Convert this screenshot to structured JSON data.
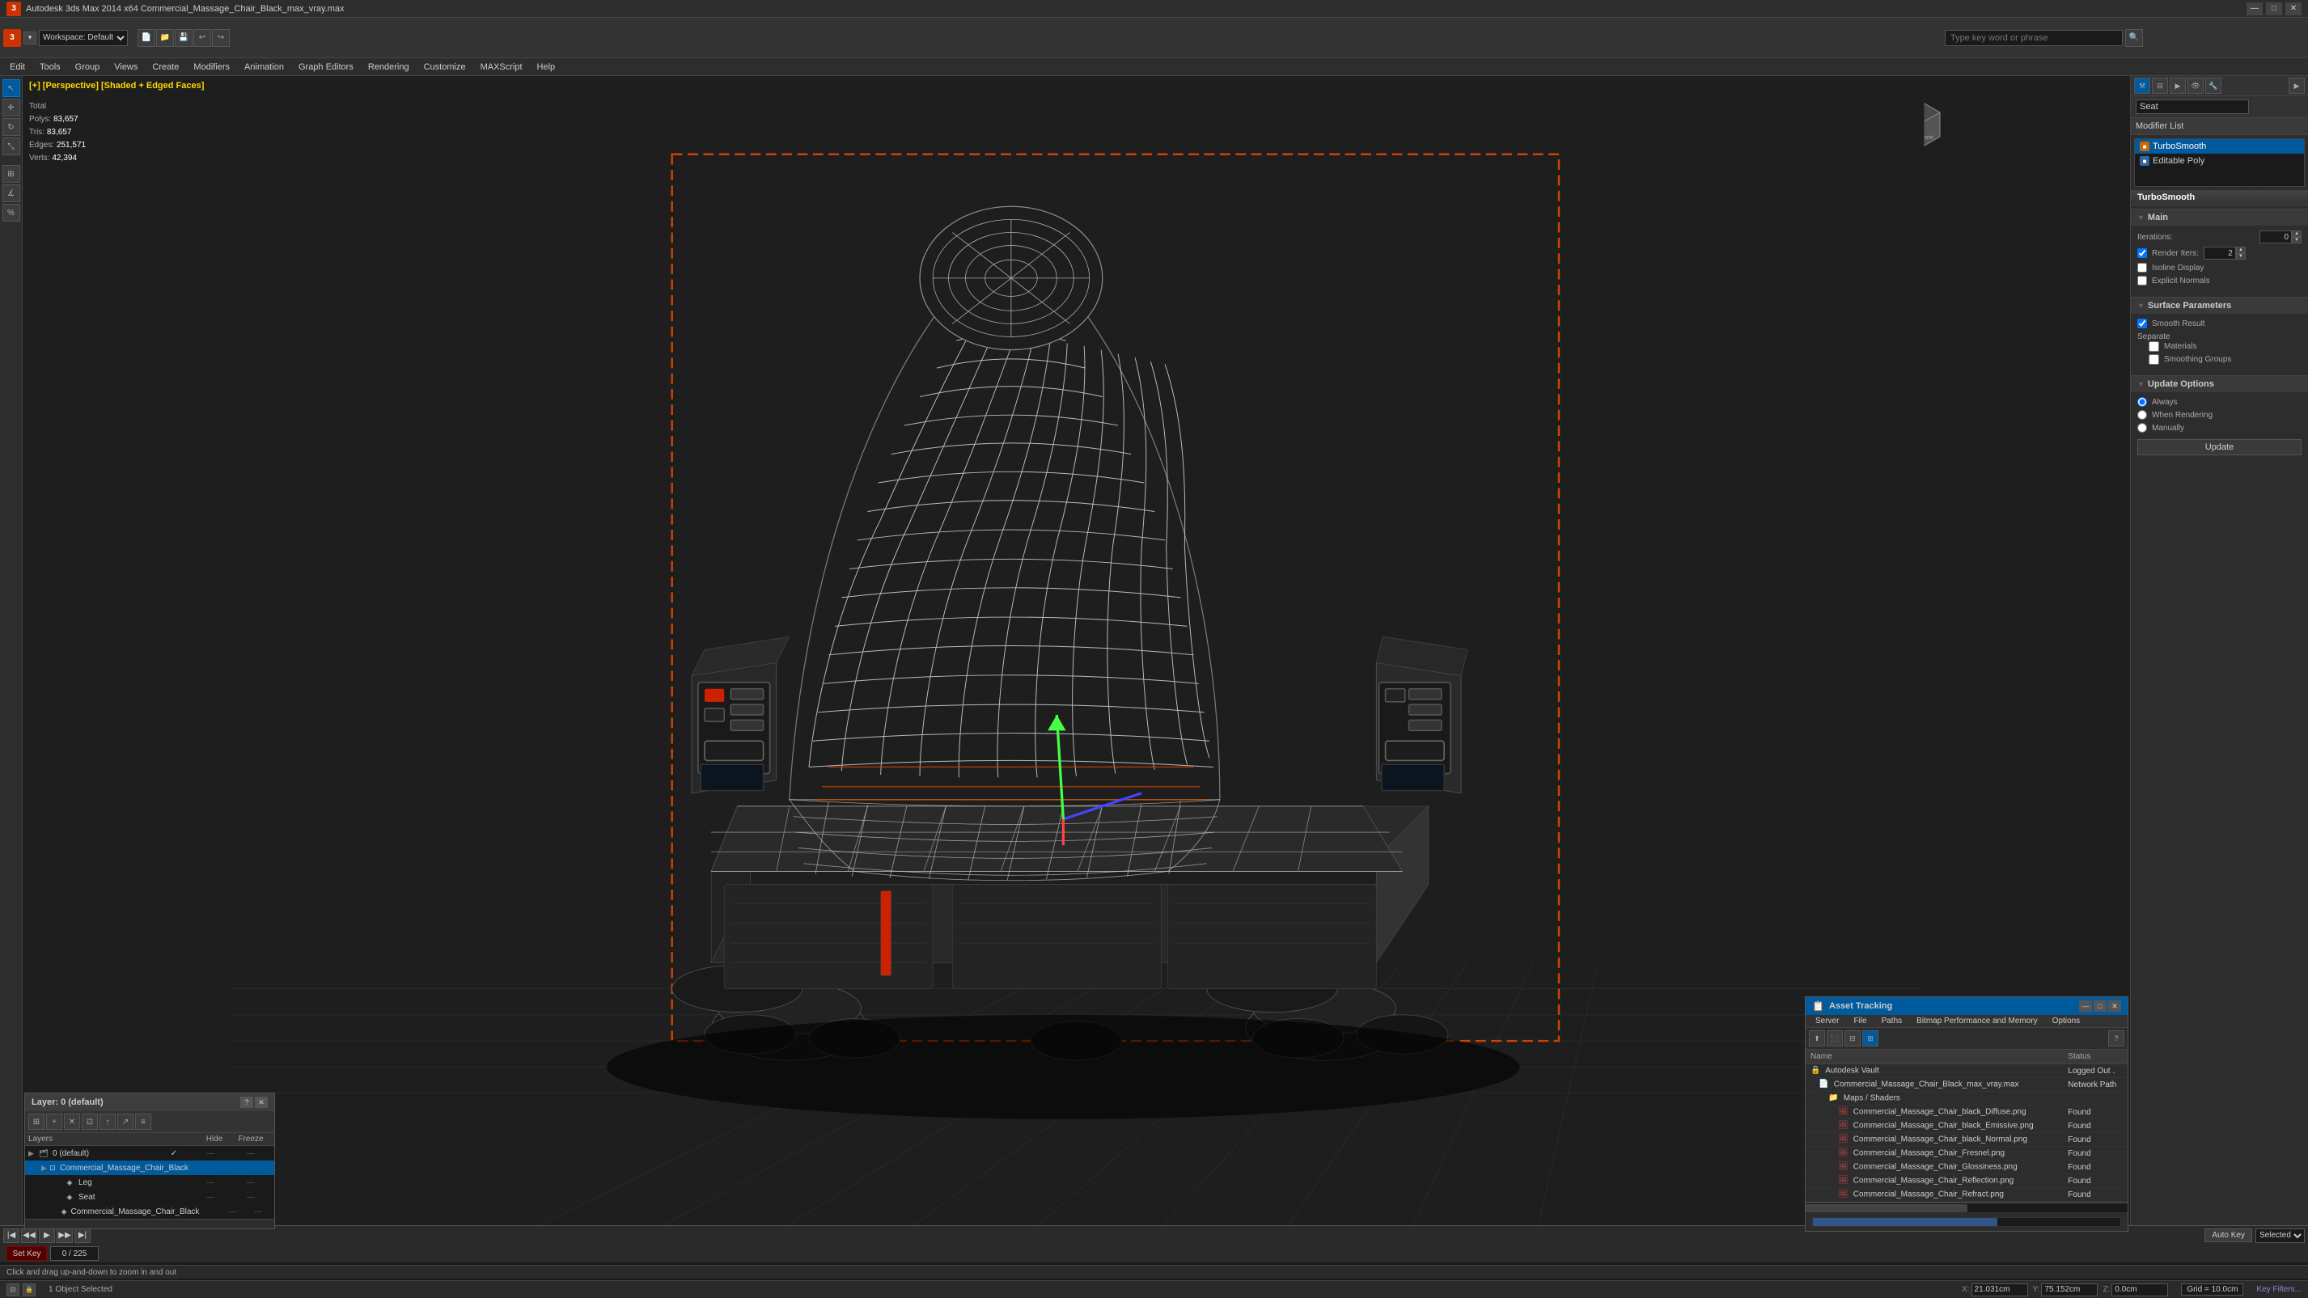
{
  "window": {
    "title": "Autodesk 3ds Max 2014 x64    Commercial_Massage_Chair_Black_max_vray.max",
    "close": "✕",
    "maximize": "□",
    "minimize": "—"
  },
  "toolbar": {
    "workspace": "Workspace: Default",
    "search_placeholder": "Type key word or phrase"
  },
  "menu": {
    "items": [
      "Edit",
      "Tools",
      "Group",
      "Views",
      "Create",
      "Modifiers",
      "Animation",
      "Graph Editors",
      "Rendering",
      "Customize",
      "MAXScript",
      "Help"
    ]
  },
  "viewport": {
    "label": "[+] [Perspective] [Shaded + Edged Faces]",
    "stats": {
      "total_label": "Total",
      "polys_label": "Polys:",
      "polys_val": "83,657",
      "tris_label": "Tris:",
      "tris_val": "83,657",
      "edges_label": "Edges:",
      "edges_val": "251,571",
      "verts_label": "Verts:",
      "verts_val": "42,394"
    }
  },
  "modifier_panel": {
    "object_name": "Seat",
    "modifier_list_label": "Modifier List",
    "close_btn": "▶",
    "modifiers": [
      {
        "name": "TurboSmooth",
        "type": "turbo",
        "active": true
      },
      {
        "name": "Editable Poly",
        "type": "epoly",
        "active": false
      }
    ],
    "turbosmooth_section": {
      "title": "TurboSmooth",
      "main_label": "Main",
      "iterations_label": "Iterations:",
      "iterations_val": "0",
      "render_iters_label": "Render Iters:",
      "render_iters_val": "2",
      "isoline_display_label": "Isoline Display",
      "explicit_normals_label": "Explicit Normals"
    },
    "surface_params": {
      "title": "Surface Parameters",
      "smooth_result_label": "Smooth Result",
      "smooth_result_checked": true,
      "separate_label": "Separate",
      "materials_label": "Materials",
      "smoothing_groups_label": "Smoothing Groups"
    },
    "update_options": {
      "title": "Update Options",
      "always_label": "Always",
      "when_rendering_label": "When Rendering",
      "manually_label": "Manually",
      "update_btn": "Update"
    }
  },
  "layers_panel": {
    "title": "Layer: 0 (default)",
    "question_btn": "?",
    "close_btn": "✕",
    "toolbar_icons": [
      "⊞",
      "+",
      "✕",
      "⊡",
      "↕",
      "↗",
      "≡"
    ],
    "col_layers": "Layers",
    "col_hide": "Hide",
    "col_freeze": "Freeze",
    "items": [
      {
        "name": "0 (default)",
        "level": 0,
        "type": "layer",
        "check": "✓",
        "hide": "—",
        "freeze": "—"
      },
      {
        "name": "Commercial_Massage_Chair_Black",
        "level": 1,
        "type": "group",
        "check": "",
        "hide": "—",
        "freeze": "—",
        "selected": true
      },
      {
        "name": "Leg",
        "level": 2,
        "type": "object",
        "check": "",
        "hide": "—",
        "freeze": "—"
      },
      {
        "name": "Seat",
        "level": 2,
        "type": "object",
        "check": "",
        "hide": "—",
        "freeze": "—"
      },
      {
        "name": "Commercial_Massage_Chair_Black",
        "level": 2,
        "type": "object",
        "check": "",
        "hide": "—",
        "freeze": "—"
      }
    ]
  },
  "asset_panel": {
    "title": "Asset Tracking",
    "menu_items": [
      "Server",
      "File",
      "Paths",
      "Bitmap Performance and Memory",
      "Options"
    ],
    "col_name": "Name",
    "col_status": "Status",
    "items": [
      {
        "name": "Autodesk Vault",
        "level": 0,
        "type": "vault",
        "status": "Logged Out .",
        "status_class": "loggedout"
      },
      {
        "name": "Commercial_Massage_Chair_Black_max_vray.max",
        "level": 1,
        "type": "maxfile",
        "status": "Network Path",
        "status_class": "network"
      },
      {
        "name": "Maps / Shaders",
        "level": 2,
        "type": "folder",
        "status": "",
        "status_class": ""
      },
      {
        "name": "Commercial_Massage_Chair_black_Diffuse.png",
        "level": 3,
        "type": "image",
        "status": "Found",
        "status_class": "found"
      },
      {
        "name": "Commercial_Massage_Chair_black_Emissive.png",
        "level": 3,
        "type": "image",
        "status": "Found",
        "status_class": "found"
      },
      {
        "name": "Commercial_Massage_Chair_black_Normal.png",
        "level": 3,
        "type": "image",
        "status": "Found",
        "status_class": "found"
      },
      {
        "name": "Commercial_Massage_Chair_Fresnel.png",
        "level": 3,
        "type": "image",
        "status": "Found",
        "status_class": "found"
      },
      {
        "name": "Commercial_Massage_Chair_Glossiness.png",
        "level": 3,
        "type": "image",
        "status": "Found",
        "status_class": "found"
      },
      {
        "name": "Commercial_Massage_Chair_Reflection.png",
        "level": 3,
        "type": "image",
        "status": "Found",
        "status_class": "found"
      },
      {
        "name": "Commercial_Massage_Chair_Refract.png",
        "level": 3,
        "type": "image",
        "status": "Found",
        "status_class": "found"
      }
    ]
  },
  "timeline": {
    "current_frame": "0",
    "total_frames": "225",
    "frame_label": "0 / 225"
  },
  "status_bar": {
    "objects_selected": "1 Object Selected",
    "hint": "Click and drag up-and-down to zoom in and out",
    "grid_label": "Grid = 10.0cm",
    "coords": {
      "x_label": "X:",
      "x_val": "21.031cm",
      "y_label": "Y:",
      "y_val": "75.152cm",
      "z_label": "Z:",
      "z_val": "0.0cm"
    },
    "autokey": "Auto Key",
    "selected": "Selected",
    "set_key": "Set Key",
    "key_filters": "Key Filters..."
  }
}
